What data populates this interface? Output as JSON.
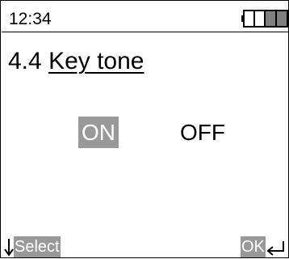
{
  "status": {
    "time": "12:34",
    "battery_icon": "battery-icon",
    "battery_level": 0.4
  },
  "page": {
    "number": "4.4",
    "name": "Key tone"
  },
  "options": {
    "on_label": "ON",
    "off_label": "OFF",
    "selected": "ON"
  },
  "softkeys": {
    "left_label": "Select",
    "left_icon": "arrow-down-icon",
    "right_label": "OK",
    "right_icon": "enter-return-icon"
  },
  "colors": {
    "highlight": "#999999",
    "highlight_text": "#ffffff",
    "text": "#000000",
    "background": "#ffffff"
  }
}
